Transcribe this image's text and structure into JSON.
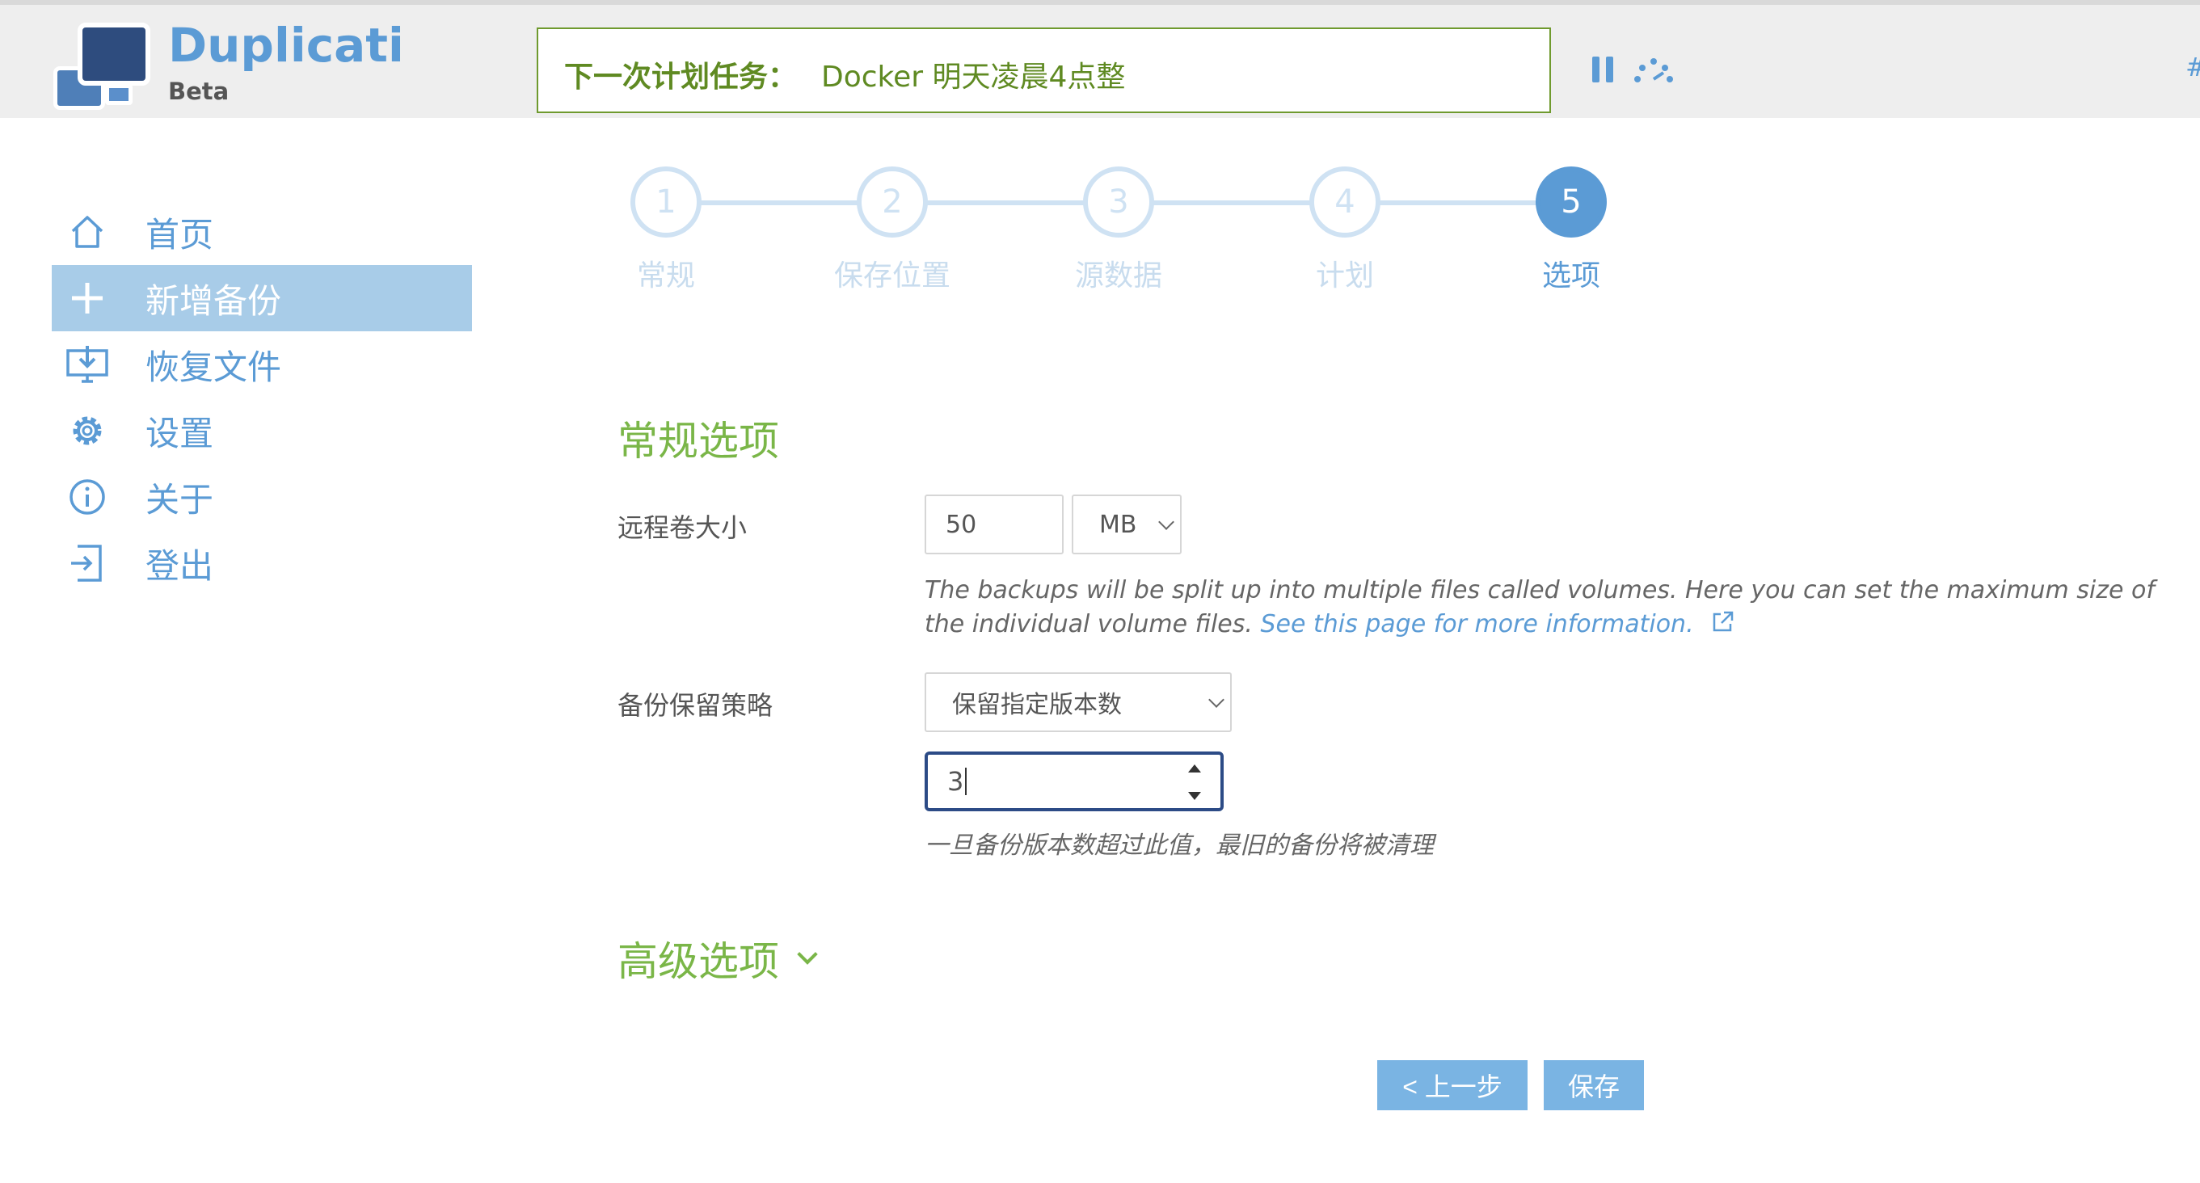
{
  "header": {
    "brand": "Duplicati",
    "brand_sub": "Beta",
    "next_task_label": "下一次计划任务：",
    "next_task_value": "Docker 明天凌晨4点整",
    "edge_glyph": "#"
  },
  "sidebar": {
    "items": [
      {
        "label": "首页",
        "icon": "home-icon"
      },
      {
        "label": "新增备份",
        "icon": "plus-icon",
        "active": true
      },
      {
        "label": "恢复文件",
        "icon": "restore-icon"
      },
      {
        "label": "设置",
        "icon": "gear-icon"
      },
      {
        "label": "关于",
        "icon": "info-icon"
      },
      {
        "label": "登出",
        "icon": "logout-icon"
      }
    ]
  },
  "stepper": {
    "steps": [
      {
        "number": "1",
        "label": "常规"
      },
      {
        "number": "2",
        "label": "保存位置"
      },
      {
        "number": "3",
        "label": "源数据"
      },
      {
        "number": "4",
        "label": "计划"
      },
      {
        "number": "5",
        "label": "选项",
        "active": true
      }
    ]
  },
  "general": {
    "title": "常规选项",
    "volume_label": "远程卷大小",
    "volume_value": "50",
    "volume_unit": "MB",
    "volume_help": "The backups will be split up into multiple files called volumes. Here you can set the maximum size of the individual volume files.",
    "volume_help_link": "See this page for more information.",
    "retention_label": "备份保留策略",
    "retention_value": "保留指定版本数",
    "retention_count": "3",
    "retention_help": "一旦备份版本数超过此值，最旧的备份将被清理"
  },
  "advanced": {
    "title": "高级选项"
  },
  "actions": {
    "prev_label": "< 上一步",
    "save_label": "保存"
  },
  "colors": {
    "accent_blue": "#5b9bd5",
    "accent_green": "#7ab648",
    "active_nav": "#a8cce8"
  }
}
